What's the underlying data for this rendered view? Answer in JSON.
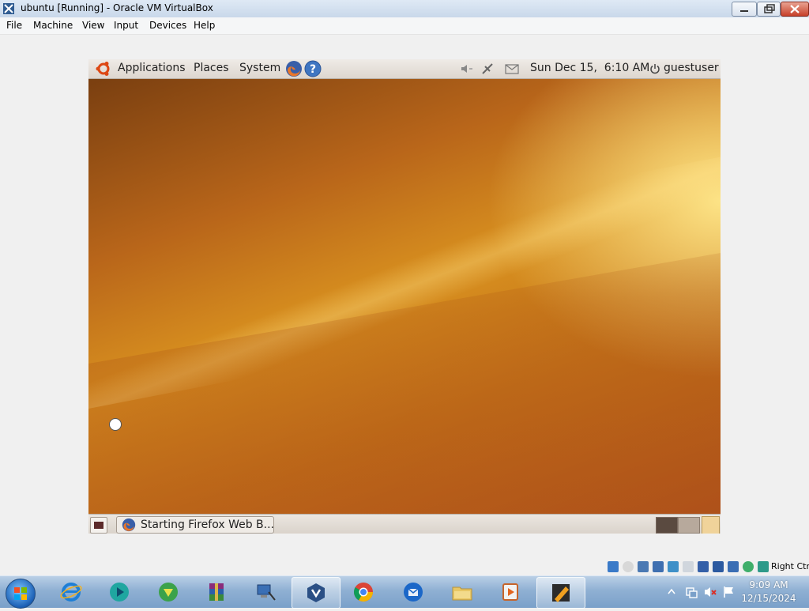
{
  "window": {
    "title": "ubuntu [Running] - Oracle VM VirtualBox",
    "icon": "virtualbox-icon",
    "controls": [
      "minimize-icon",
      "restore-icon",
      "close-icon"
    ]
  },
  "menubar": {
    "items": [
      {
        "label": "File"
      },
      {
        "label": "Machine"
      },
      {
        "label": "View"
      },
      {
        "label": "Input"
      },
      {
        "label": "Devices"
      },
      {
        "label": "Help"
      }
    ]
  },
  "guest": {
    "top_panel": {
      "menus": [
        {
          "label": "Applications"
        },
        {
          "label": "Places"
        },
        {
          "label": "System"
        }
      ],
      "launchers": [
        "firefox-icon",
        "help-icon"
      ],
      "indicators": [
        "volume-icon",
        "network-icon",
        "mail-icon"
      ],
      "datetime": "Sun Dec 15,  6:10 AM",
      "user": "guestuser"
    },
    "bottom_panel": {
      "task": {
        "label": "Starting Firefox Web B..."
      },
      "workspaces": 2
    },
    "colors": {
      "panel": "#e6e0da",
      "wallpaper_light": "#f7d35a",
      "wallpaper_dark": "#7a3f10"
    }
  },
  "vbox_status": {
    "icons": [
      "hdd-icon",
      "optical-icon",
      "usb-icon",
      "network-icon",
      "shared-folder-icon",
      "display-icon",
      "video-capture-icon",
      "cpu-icon",
      "mouse-integration-icon",
      "keyboard-icon"
    ],
    "host_key": "Right Ctrl"
  },
  "taskbar": {
    "items": [
      "internet-explorer-icon",
      "media-app-icon",
      "download-manager-icon",
      "winrar-icon",
      "network-tool-icon",
      "virtualbox-icon",
      "chrome-icon",
      "thunderbird-icon",
      "file-explorer-icon",
      "media-player-icon",
      "virtualbox-64-icon"
    ],
    "clock": {
      "time": "9:09 AM",
      "date": "12/15/2024"
    }
  }
}
